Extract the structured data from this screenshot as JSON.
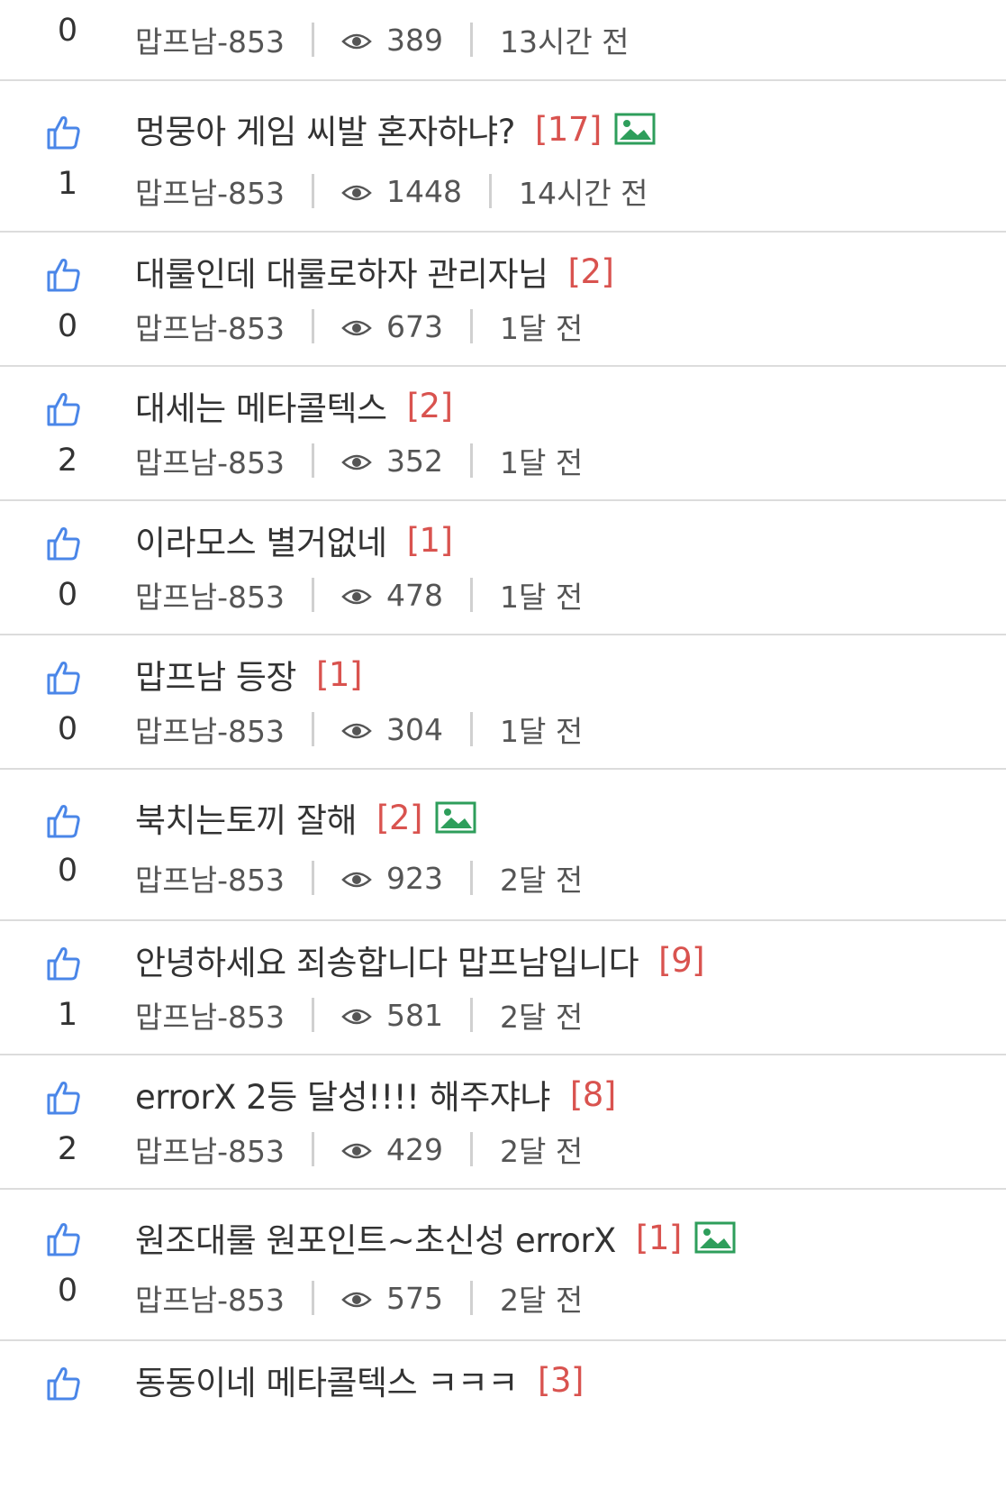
{
  "posts": [
    {
      "votes": "0",
      "title": "",
      "comments": "",
      "has_image": false,
      "author": "맙프남-853",
      "views": "389",
      "time": "13시간 전"
    },
    {
      "votes": "1",
      "title": "멍뭉아 게임 씨발 혼자하냐?",
      "comments": "[17]",
      "has_image": true,
      "author": "맙프남-853",
      "views": "1448",
      "time": "14시간 전"
    },
    {
      "votes": "0",
      "title": "대룰인데 대룰로하자 관리자님",
      "comments": "[2]",
      "has_image": false,
      "author": "맙프남-853",
      "views": "673",
      "time": "1달 전"
    },
    {
      "votes": "2",
      "title": "대세는 메타콜텍스",
      "comments": "[2]",
      "has_image": false,
      "author": "맙프남-853",
      "views": "352",
      "time": "1달 전"
    },
    {
      "votes": "0",
      "title": "이라모스 별거없네",
      "comments": "[1]",
      "has_image": false,
      "author": "맙프남-853",
      "views": "478",
      "time": "1달 전"
    },
    {
      "votes": "0",
      "title": "맙프남 등장",
      "comments": "[1]",
      "has_image": false,
      "author": "맙프남-853",
      "views": "304",
      "time": "1달 전"
    },
    {
      "votes": "0",
      "title": "북치는토끼 잘해",
      "comments": "[2]",
      "has_image": true,
      "author": "맙프남-853",
      "views": "923",
      "time": "2달 전"
    },
    {
      "votes": "1",
      "title": "안녕하세요 죄송합니다 맙프남입니다",
      "comments": "[9]",
      "has_image": false,
      "author": "맙프남-853",
      "views": "581",
      "time": "2달 전"
    },
    {
      "votes": "2",
      "title": "errorX 2등 달성!!!! 해주쟈냐",
      "comments": "[8]",
      "has_image": false,
      "author": "맙프남-853",
      "views": "429",
      "time": "2달 전"
    },
    {
      "votes": "0",
      "title": "원조대룰 원포인트~초신성 errorX",
      "comments": "[1]",
      "has_image": true,
      "author": "맙프남-853",
      "views": "575",
      "time": "2달 전"
    },
    {
      "votes": "",
      "title": "동동이네 메타콜텍스 ㅋㅋㅋ",
      "comments": "[3]",
      "has_image": false,
      "author": "",
      "views": "",
      "time": ""
    }
  ],
  "colors": {
    "accent_thumb": "#4a86e8",
    "comment_count": "#d9534f",
    "image_icon": "#2e9e5b",
    "divider": "#dcdcdc"
  },
  "icons": {
    "like": "thumbs-up-icon",
    "views": "eye-icon",
    "attachment": "image-icon"
  }
}
